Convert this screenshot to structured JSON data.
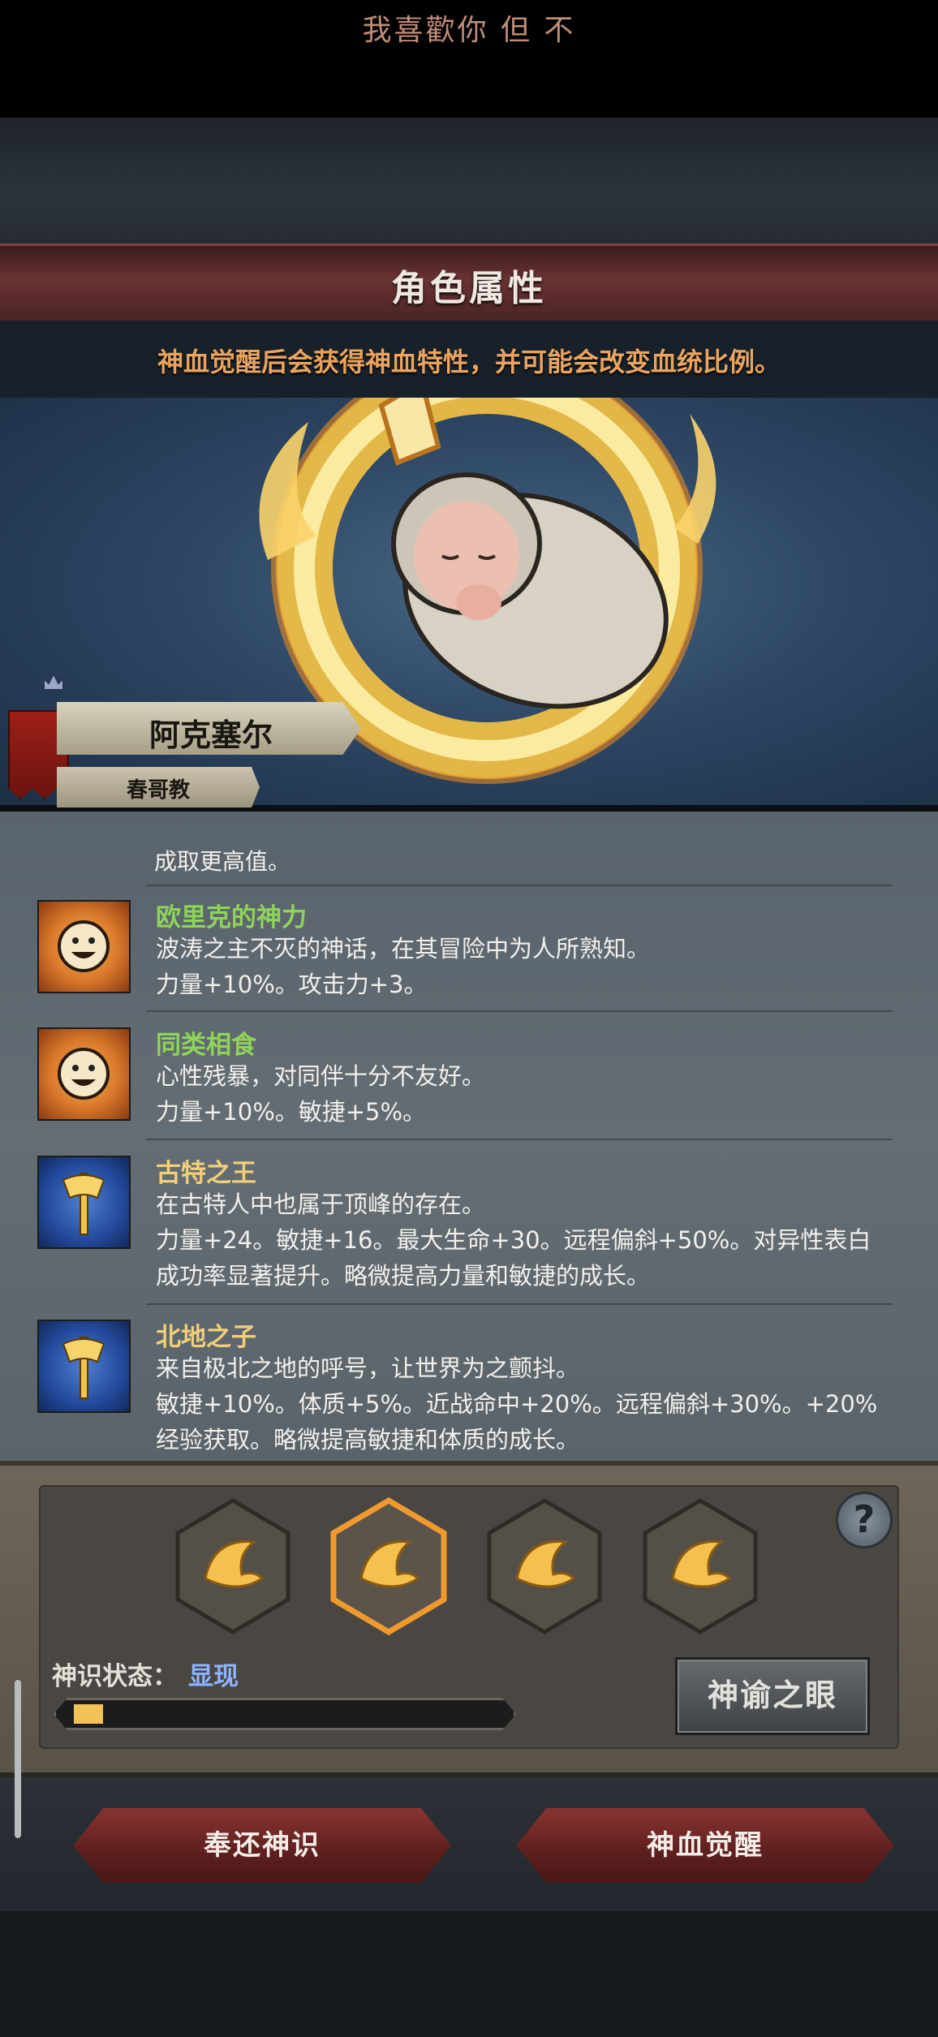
{
  "marquee": "我喜歡你 但 不",
  "title": "角色属性",
  "hint": "神血觉醒后会获得神血特性，并可能会改变血统比例。",
  "character": {
    "name": "阿克塞尔",
    "faith": "春哥教"
  },
  "traits_cut": [
    "成取更高值。"
  ],
  "traits": [
    {
      "name": "欧里克的神力",
      "name_color": "#8fd45a",
      "icon": "smiley-sun-icon",
      "desc1": "波涛之主不灭的神话，在其冒险中为人所熟知。",
      "desc2": "力量+10%。攻击力+3。"
    },
    {
      "name": "同类相食",
      "name_color": "#8fd45a",
      "icon": "smiley-sun-icon",
      "desc1": "心性残暴，对同伴十分不友好。",
      "desc2": "力量+10%。敏捷+5%。"
    },
    {
      "name": "古特之王",
      "name_color": "#f1cf78",
      "icon": "golden-axe-icon",
      "desc1": "在古特人中也属于顶峰的存在。",
      "desc2": "力量+24。敏捷+16。最大生命+30。远程偏斜+50%。对异性表白成功率显著提升。略微提高力量和敏捷的成长。"
    },
    {
      "name": "北地之子",
      "name_color": "#f1cf78",
      "icon": "golden-axe-icon",
      "desc1": "来自极北之地的呼号，让世界为之颤抖。",
      "desc2": "敏捷+10%。体质+5%。近战命中+20%。远程偏斜+30%。+20%经验获取。略微提高敏捷和体质的成长。"
    }
  ],
  "awaken": {
    "state_label": "神识状态：",
    "state_value": "显现",
    "progress": 0.07,
    "oracle_button": "神谕之眼",
    "help": "?"
  },
  "buttons": {
    "return": "奉还神识",
    "awaken": "神血觉醒"
  }
}
